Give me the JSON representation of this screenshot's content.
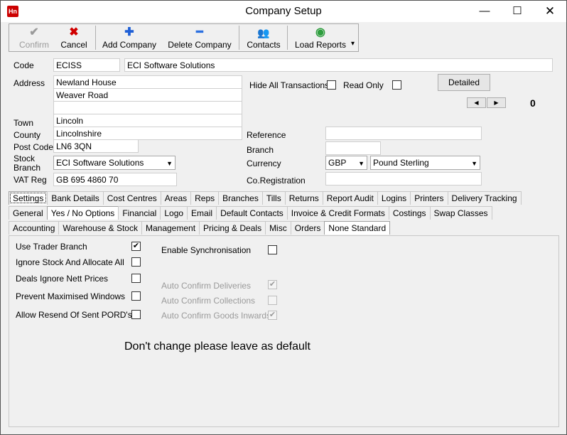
{
  "window": {
    "app_icon": "Hn",
    "title": "Company Setup",
    "minimize": "—",
    "maximize": "☐",
    "close": "✕"
  },
  "toolbar": {
    "confirm": {
      "label": "Confirm",
      "icon": "✔"
    },
    "cancel": {
      "label": "Cancel",
      "icon": "✖"
    },
    "add_company": {
      "label": "Add Company",
      "icon": "✚"
    },
    "delete_company": {
      "label": "Delete Company",
      "icon": "━"
    },
    "contacts": {
      "label": "Contacts",
      "icon": "👥"
    },
    "load_reports": {
      "label": "Load Reports",
      "icon": "◉",
      "dropdown": "▾"
    }
  },
  "form": {
    "code_label": "Code",
    "code": "ECISS",
    "name": "ECI Software Solutions",
    "address_label": "Address",
    "address1": "Newland House",
    "address2": "Weaver Road",
    "address3": "",
    "town_label": "Town",
    "town": "Lincoln",
    "county_label": "County",
    "county": "Lincolnshire",
    "postcode_label": "Post Code",
    "postcode": "LN6 3QN",
    "stock_branch_label": "Stock Branch",
    "stock_branch": "ECI Software Solutions",
    "vat_label": "VAT Reg",
    "vat": "GB 695 4860 70",
    "hide_all_label": "Hide All Transactions",
    "read_only_label": "Read Only",
    "detailed_button": "Detailed",
    "prev": "◀",
    "next": "▶",
    "counter": "0",
    "reference_label": "Reference",
    "reference": "",
    "branch_label": "Branch",
    "branch": "",
    "currency_label": "Currency",
    "currency_code": "GBP",
    "currency_name": "Pound Sterling",
    "coreg_label": "Co.Registration",
    "coreg": "",
    "combo_arrow": "▼"
  },
  "tabs_row1": [
    "Settings",
    "Bank Details",
    "Cost Centres",
    "Areas",
    "Reps",
    "Branches",
    "Tills",
    "Returns",
    "Report Audit",
    "Logins",
    "Printers",
    "Delivery Tracking"
  ],
  "tabs_row2": [
    "General",
    "Yes / No Options",
    "Financial",
    "Logo",
    "Email",
    "Default Contacts",
    "Invoice & Credit Formats",
    "Costings",
    "Swap Classes"
  ],
  "tabs_row3": [
    "Accounting",
    "Warehouse & Stock",
    "Management",
    "Pricing & Deals",
    "Misc",
    "Orders",
    "None Standard"
  ],
  "options": {
    "use_trader_branch": {
      "label": "Use Trader Branch",
      "checked": "✔"
    },
    "ignore_stock": {
      "label": "Ignore Stock And Allocate All",
      "checked": ""
    },
    "deals_ignore_nett": {
      "label": "Deals Ignore Nett Prices",
      "checked": ""
    },
    "prevent_maximised": {
      "label": "Prevent Maximised Windows",
      "checked": ""
    },
    "allow_resend": {
      "label": "Allow Resend Of Sent PORD's",
      "checked": ""
    },
    "enable_sync": {
      "label": "Enable Synchronisation",
      "checked": ""
    },
    "auto_confirm_deliveries": {
      "label": "Auto Confirm Deliveries",
      "checked": "✔"
    },
    "auto_confirm_collections": {
      "label": "Auto Confirm Collections",
      "checked": ""
    },
    "auto_confirm_goods": {
      "label": "Auto Confirm Goods Inwards",
      "checked": "✔"
    }
  },
  "note": "Don't change please leave as default",
  "colors": {
    "cancel_red": "#d00000",
    "add_blue": "#1f5fd6",
    "delete_blue": "#2a6fe0",
    "reports_green": "#2e9e3e"
  }
}
